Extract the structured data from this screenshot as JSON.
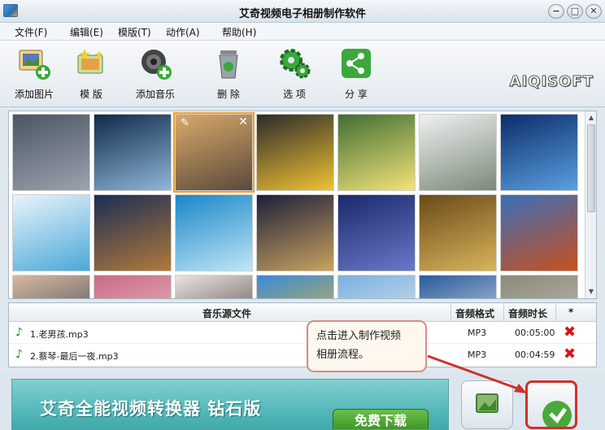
{
  "window": {
    "title": "艾奇视频电子相册制作软件",
    "min": "−",
    "max": "□",
    "close": "✕"
  },
  "menu": [
    "文件(F)",
    "编辑(E)",
    "模版(T)",
    "动作(A)",
    "帮助(H)"
  ],
  "toolbar": {
    "add_image": "添加图片",
    "template": "模 版",
    "add_music": "添加音乐",
    "delete": "删 除",
    "options": "选 项",
    "share": "分 享",
    "logo": "AIQISOFT"
  },
  "colors": {
    "accent": "#f0a030",
    "delete_red": "#d11111",
    "callout_border": "#d88a86",
    "banner": "#3ea9ab"
  },
  "thumbs": [
    {
      "name": "eiffel-tower",
      "colors": [
        "#4b5563",
        "#9ca3af"
      ]
    },
    {
      "name": "earth-clouds",
      "colors": [
        "#0f2a4a",
        "#8fb7d8"
      ]
    },
    {
      "name": "stonehenge",
      "colors": [
        "#d9a86a",
        "#5a4a3a"
      ],
      "selected": true
    },
    {
      "name": "zen-stones-flower",
      "colors": [
        "#2b2b2b",
        "#f1c232"
      ]
    },
    {
      "name": "duckling",
      "colors": [
        "#3f6f32",
        "#f4e27a"
      ]
    },
    {
      "name": "ferris-wheel",
      "colors": [
        "#f0f0f0",
        "#7a8a7a"
      ]
    },
    {
      "name": "sydney-bridge",
      "colors": [
        "#0d2c6b",
        "#5aa0e0"
      ]
    },
    {
      "name": "eiffel-blue",
      "colors": [
        "#e9f4fb",
        "#4aa8d8"
      ]
    },
    {
      "name": "colosseum",
      "colors": [
        "#1c2d55",
        "#b07a3a"
      ]
    },
    {
      "name": "water-wave",
      "colors": [
        "#1a86c8",
        "#bfe6f6"
      ]
    },
    {
      "name": "chateau",
      "colors": [
        "#1d1f3a",
        "#c9a35f"
      ]
    },
    {
      "name": "tower-bridge",
      "colors": [
        "#1a2a6b",
        "#6a78c8"
      ]
    },
    {
      "name": "eiffel-sepia",
      "colors": [
        "#6b4a1a",
        "#d9b45a"
      ]
    },
    {
      "name": "desert-canyon",
      "colors": [
        "#3b6fb8",
        "#c8501e"
      ]
    },
    {
      "name": "portrait-woman",
      "colors": [
        "#d8b8a0",
        "#2a3a4a"
      ]
    },
    {
      "name": "flowers-pink",
      "colors": [
        "#c86a8a",
        "#f2c8c0"
      ]
    },
    {
      "name": "girl-photo",
      "colors": [
        "#e9e4e0",
        "#3a2a2a"
      ]
    },
    {
      "name": "yellow-flowers",
      "colors": [
        "#3a8ad8",
        "#f4c020"
      ]
    },
    {
      "name": "penguins",
      "colors": [
        "#7ab0e0",
        "#f0f0f0"
      ]
    },
    {
      "name": "sea-sky",
      "colors": [
        "#2a5a9a",
        "#e6eef6"
      ]
    },
    {
      "name": "koala",
      "colors": [
        "#8a8a7a",
        "#c8c4b8"
      ]
    }
  ],
  "music": {
    "headers": {
      "file": "音乐源文件",
      "format": "音频格式",
      "duration": "音频时长",
      "star": "*"
    },
    "rows": [
      {
        "name": "1.老男孩.mp3",
        "format": "MP3",
        "duration": "00:05:00"
      },
      {
        "name": "2.蔡琴-最后一夜.mp3",
        "format": "MP3",
        "duration": "00:04:59"
      }
    ]
  },
  "callout": {
    "line1": "点击进入制作视频",
    "line2": "相册流程。"
  },
  "banner": {
    "text": "艾奇全能视频转换器 钻石版",
    "download": "免费下载"
  }
}
